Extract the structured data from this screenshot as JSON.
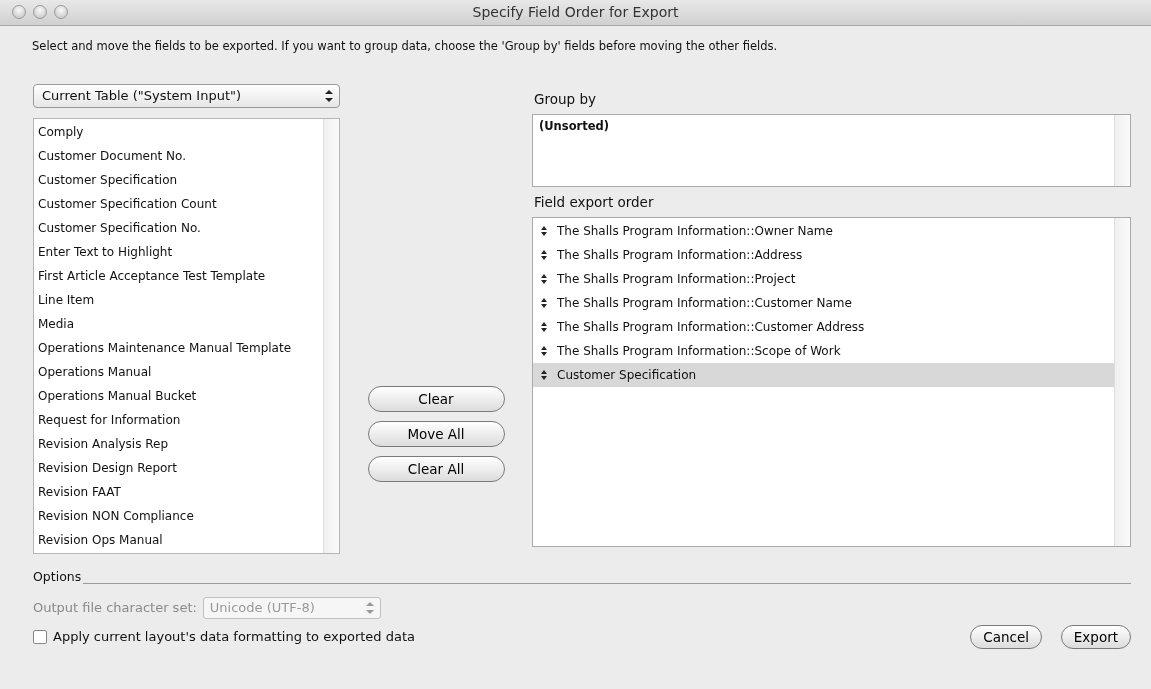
{
  "window": {
    "title": "Specify Field Order for Export"
  },
  "instructions": "Select and move the fields to be exported.  If you want to group data, choose the 'Group by' fields before moving the other fields.",
  "table_select": {
    "value": "Current Table (\"System Input\")"
  },
  "available_fields": [
    {
      "label": "Comply",
      "selected": false
    },
    {
      "label": "Customer Document No.",
      "selected": false
    },
    {
      "label": "Customer Specification",
      "selected": false
    },
    {
      "label": "Customer Specification Count",
      "selected": false
    },
    {
      "label": "Customer Specification No.",
      "selected": false
    },
    {
      "label": "Enter Text to Highlight",
      "selected": false
    },
    {
      "label": "First Article Acceptance Test Template",
      "selected": false
    },
    {
      "label": "Line Item",
      "selected": false
    },
    {
      "label": "Media",
      "selected": false
    },
    {
      "label": "Operations Maintenance Manual Template",
      "selected": false
    },
    {
      "label": "Operations Manual",
      "selected": false
    },
    {
      "label": "Operations Manual Bucket",
      "selected": false
    },
    {
      "label": "Request for Information",
      "selected": false
    },
    {
      "label": "Revision Analysis Rep",
      "selected": false
    },
    {
      "label": "Revision Design Report",
      "selected": false
    },
    {
      "label": "Revision FAAT",
      "selected": false
    },
    {
      "label": "Revision NON Compliance",
      "selected": false
    },
    {
      "label": "Revision Ops Manual",
      "selected": false
    }
  ],
  "middle_buttons": [
    "Clear",
    "Move All",
    "Clear All"
  ],
  "group_by": {
    "label": "Group by",
    "items": [
      "(Unsorted)"
    ]
  },
  "field_export_order": {
    "label": "Field export order",
    "items": [
      {
        "label": "The Shalls Program Information::Owner Name",
        "selected": false
      },
      {
        "label": "The Shalls Program Information::Address",
        "selected": false
      },
      {
        "label": "The Shalls Program Information::Project",
        "selected": false
      },
      {
        "label": "The Shalls Program Information::Customer Name",
        "selected": false
      },
      {
        "label": "The Shalls Program Information::Customer Address",
        "selected": false
      },
      {
        "label": "The Shalls Program Information::Scope of Work",
        "selected": false
      },
      {
        "label": "Customer Specification",
        "selected": true
      }
    ]
  },
  "options": {
    "label": "Options",
    "charset": {
      "label": "Output file character set:",
      "value": "Unicode (UTF-8)",
      "disabled": true
    },
    "apply_formatting": {
      "label": "Apply current layout's data formatting to exported data",
      "checked": false
    }
  },
  "footer_buttons": [
    "Cancel",
    "Export"
  ]
}
